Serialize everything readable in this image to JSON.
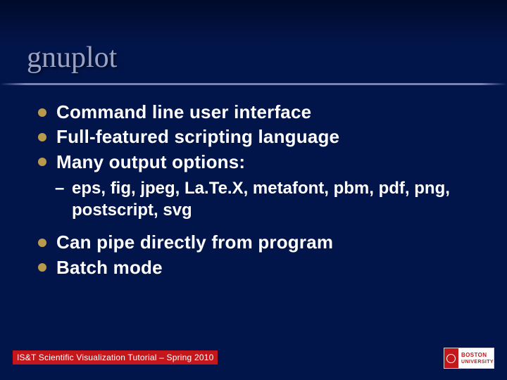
{
  "title": "gnuplot",
  "bullets": {
    "b0": "Command line user interface",
    "b1": "Full-featured scripting language",
    "b2": "Many output options:",
    "sub0": "eps, fig, jpeg, La.Te.X, metafont, pbm, pdf, png, postscript, svg",
    "b3": "Can pipe directly from program",
    "b4": "Batch mode"
  },
  "footer": "IS&T Scientific Visualization Tutorial – Spring 2010",
  "logo": {
    "line1": "BOSTON",
    "line2": "UNIVERSITY"
  }
}
